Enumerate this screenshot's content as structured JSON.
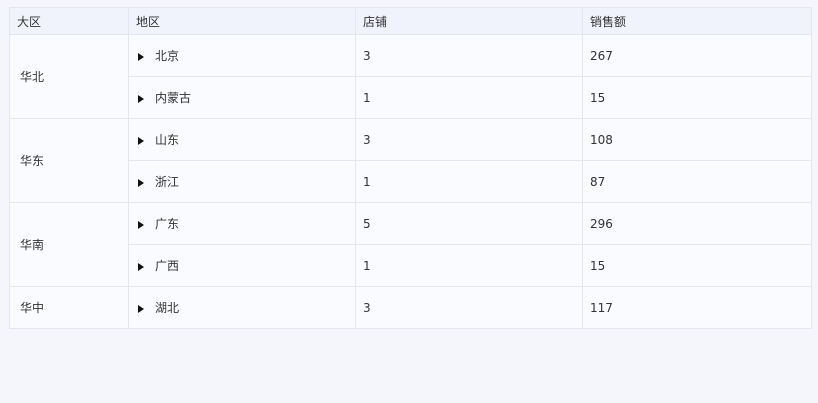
{
  "table": {
    "headers": [
      "大区",
      "地区",
      "店铺",
      "销售额"
    ],
    "groups": [
      {
        "name": "华北",
        "rows": [
          {
            "area": "北京",
            "stores": "3",
            "sales": "267"
          },
          {
            "area": "内蒙古",
            "stores": "1",
            "sales": "15"
          }
        ]
      },
      {
        "name": "华东",
        "rows": [
          {
            "area": "山东",
            "stores": "3",
            "sales": "108"
          },
          {
            "area": "浙江",
            "stores": "1",
            "sales": "87"
          }
        ]
      },
      {
        "name": "华南",
        "rows": [
          {
            "area": "广东",
            "stores": "5",
            "sales": "296"
          },
          {
            "area": "广西",
            "stores": "1",
            "sales": "15"
          }
        ]
      },
      {
        "name": "华中",
        "rows": [
          {
            "area": "湖北",
            "stores": "3",
            "sales": "117"
          }
        ]
      }
    ]
  },
  "icons": {
    "row_toggle": "caret-right-icon"
  }
}
